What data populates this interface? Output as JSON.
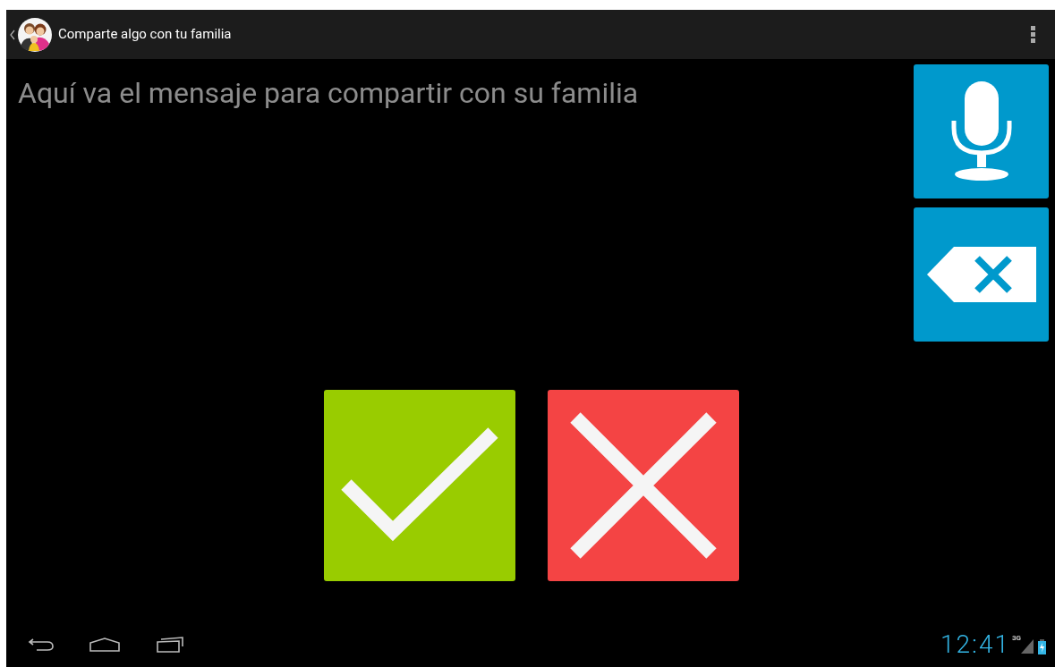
{
  "action_bar": {
    "title": "Comparte algo con tu familia"
  },
  "message": {
    "placeholder": "Aquí va el mensaje para compartir con su familia"
  },
  "status_bar": {
    "time": "12:41",
    "network": "3G"
  }
}
